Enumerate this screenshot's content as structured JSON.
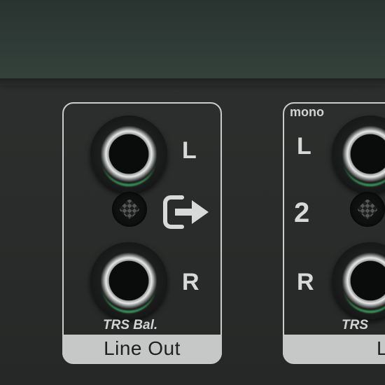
{
  "panel_left": {
    "jack_top_label": "L",
    "jack_bottom_label": "R",
    "connector_type": "TRS Bal.",
    "section_label": "Line Out",
    "output_icon": "output-arrow-icon"
  },
  "panel_right": {
    "mono_label": "mono",
    "jack_top_label": "L",
    "channel_number": "2",
    "jack_bottom_label": "R",
    "connector_type": "TRS Ba",
    "section_label_partial": "L"
  },
  "colors": {
    "panel": "#2b2d2c",
    "top_panel": "#2f3b36",
    "label_strip": "#c5c8c7",
    "led_glow": "#3fbf6a"
  }
}
